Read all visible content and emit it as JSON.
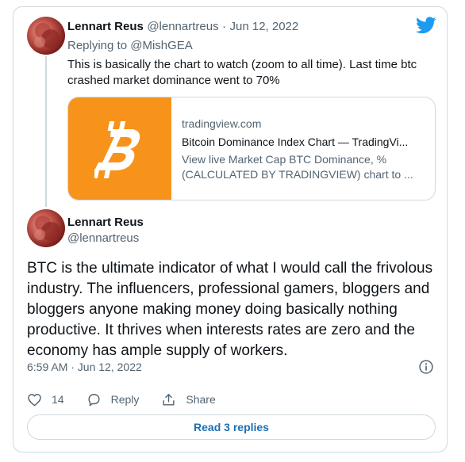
{
  "quoted_tweet": {
    "author_name": "Lennart Reus",
    "handle": "@lennartreus",
    "separator": "·",
    "date": "Jun 12, 2022",
    "replying_prefix": "Replying to",
    "replying_to": "@MishGEA",
    "text": "This is basically the chart to watch (zoom to all time). Last time btc crashed market dominance went to 70%",
    "link_card": {
      "domain": "tradingview.com",
      "title": "Bitcoin Dominance Index Chart — TradingVi...",
      "description": "View live Market Cap BTC Dominance, % (CALCULATED BY TRADINGVIEW) chart to ...",
      "thumb_color": "#f7931a"
    }
  },
  "main_tweet": {
    "author_name": "Lennart Reus",
    "handle": "@lennartreus",
    "text": "BTC is the ultimate indicator of what I would call the frivolous industry. The influencers, professional gamers, bloggers and bloggers anyone making money doing basically nothing productive. It thrives when interests rates are zero and the economy has ample supply of workers.",
    "timestamp": "6:59 AM · Jun 12, 2022"
  },
  "actions": {
    "like_count": "14",
    "reply_label": "Reply",
    "share_label": "Share"
  },
  "read_replies_label": "Read 3 replies",
  "colors": {
    "brand": "#1d9bf0",
    "link": "#1d6fb3",
    "muted": "#536471",
    "border": "#cfd9de"
  },
  "icons": [
    "twitter-bird-icon",
    "bitcoin-icon",
    "info-icon",
    "heart-icon",
    "reply-icon",
    "share-icon"
  ]
}
